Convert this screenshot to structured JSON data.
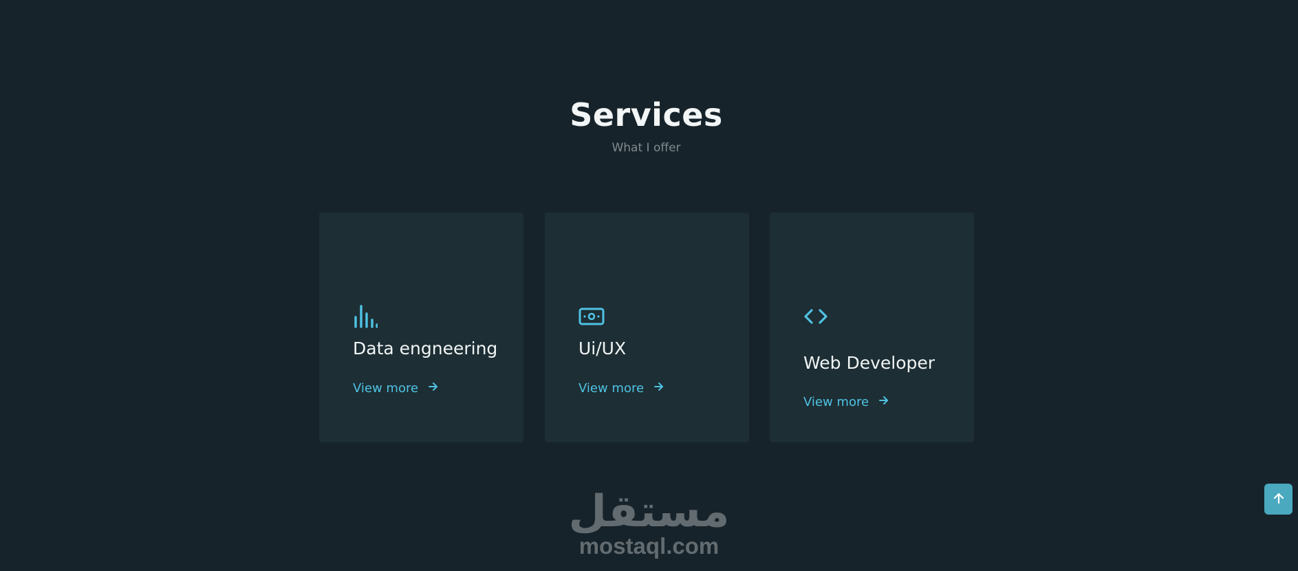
{
  "section": {
    "title": "Services",
    "subtitle": "What I offer"
  },
  "services": [
    {
      "title": "Data engneering",
      "link": "View more",
      "icon": "bar-chart-icon"
    },
    {
      "title": "Ui/UX",
      "link": "View more",
      "icon": "banknote-icon"
    },
    {
      "title": "Web Developer",
      "link": "View more",
      "icon": "code-brackets-icon"
    }
  ],
  "watermark": {
    "arabic": "مستقل",
    "latin": "mostaql.com"
  },
  "colors": {
    "background": "#17232a",
    "card": "#1d2e34",
    "accent": "#4fc3e4",
    "scroll_button": "#4aa9bf"
  }
}
